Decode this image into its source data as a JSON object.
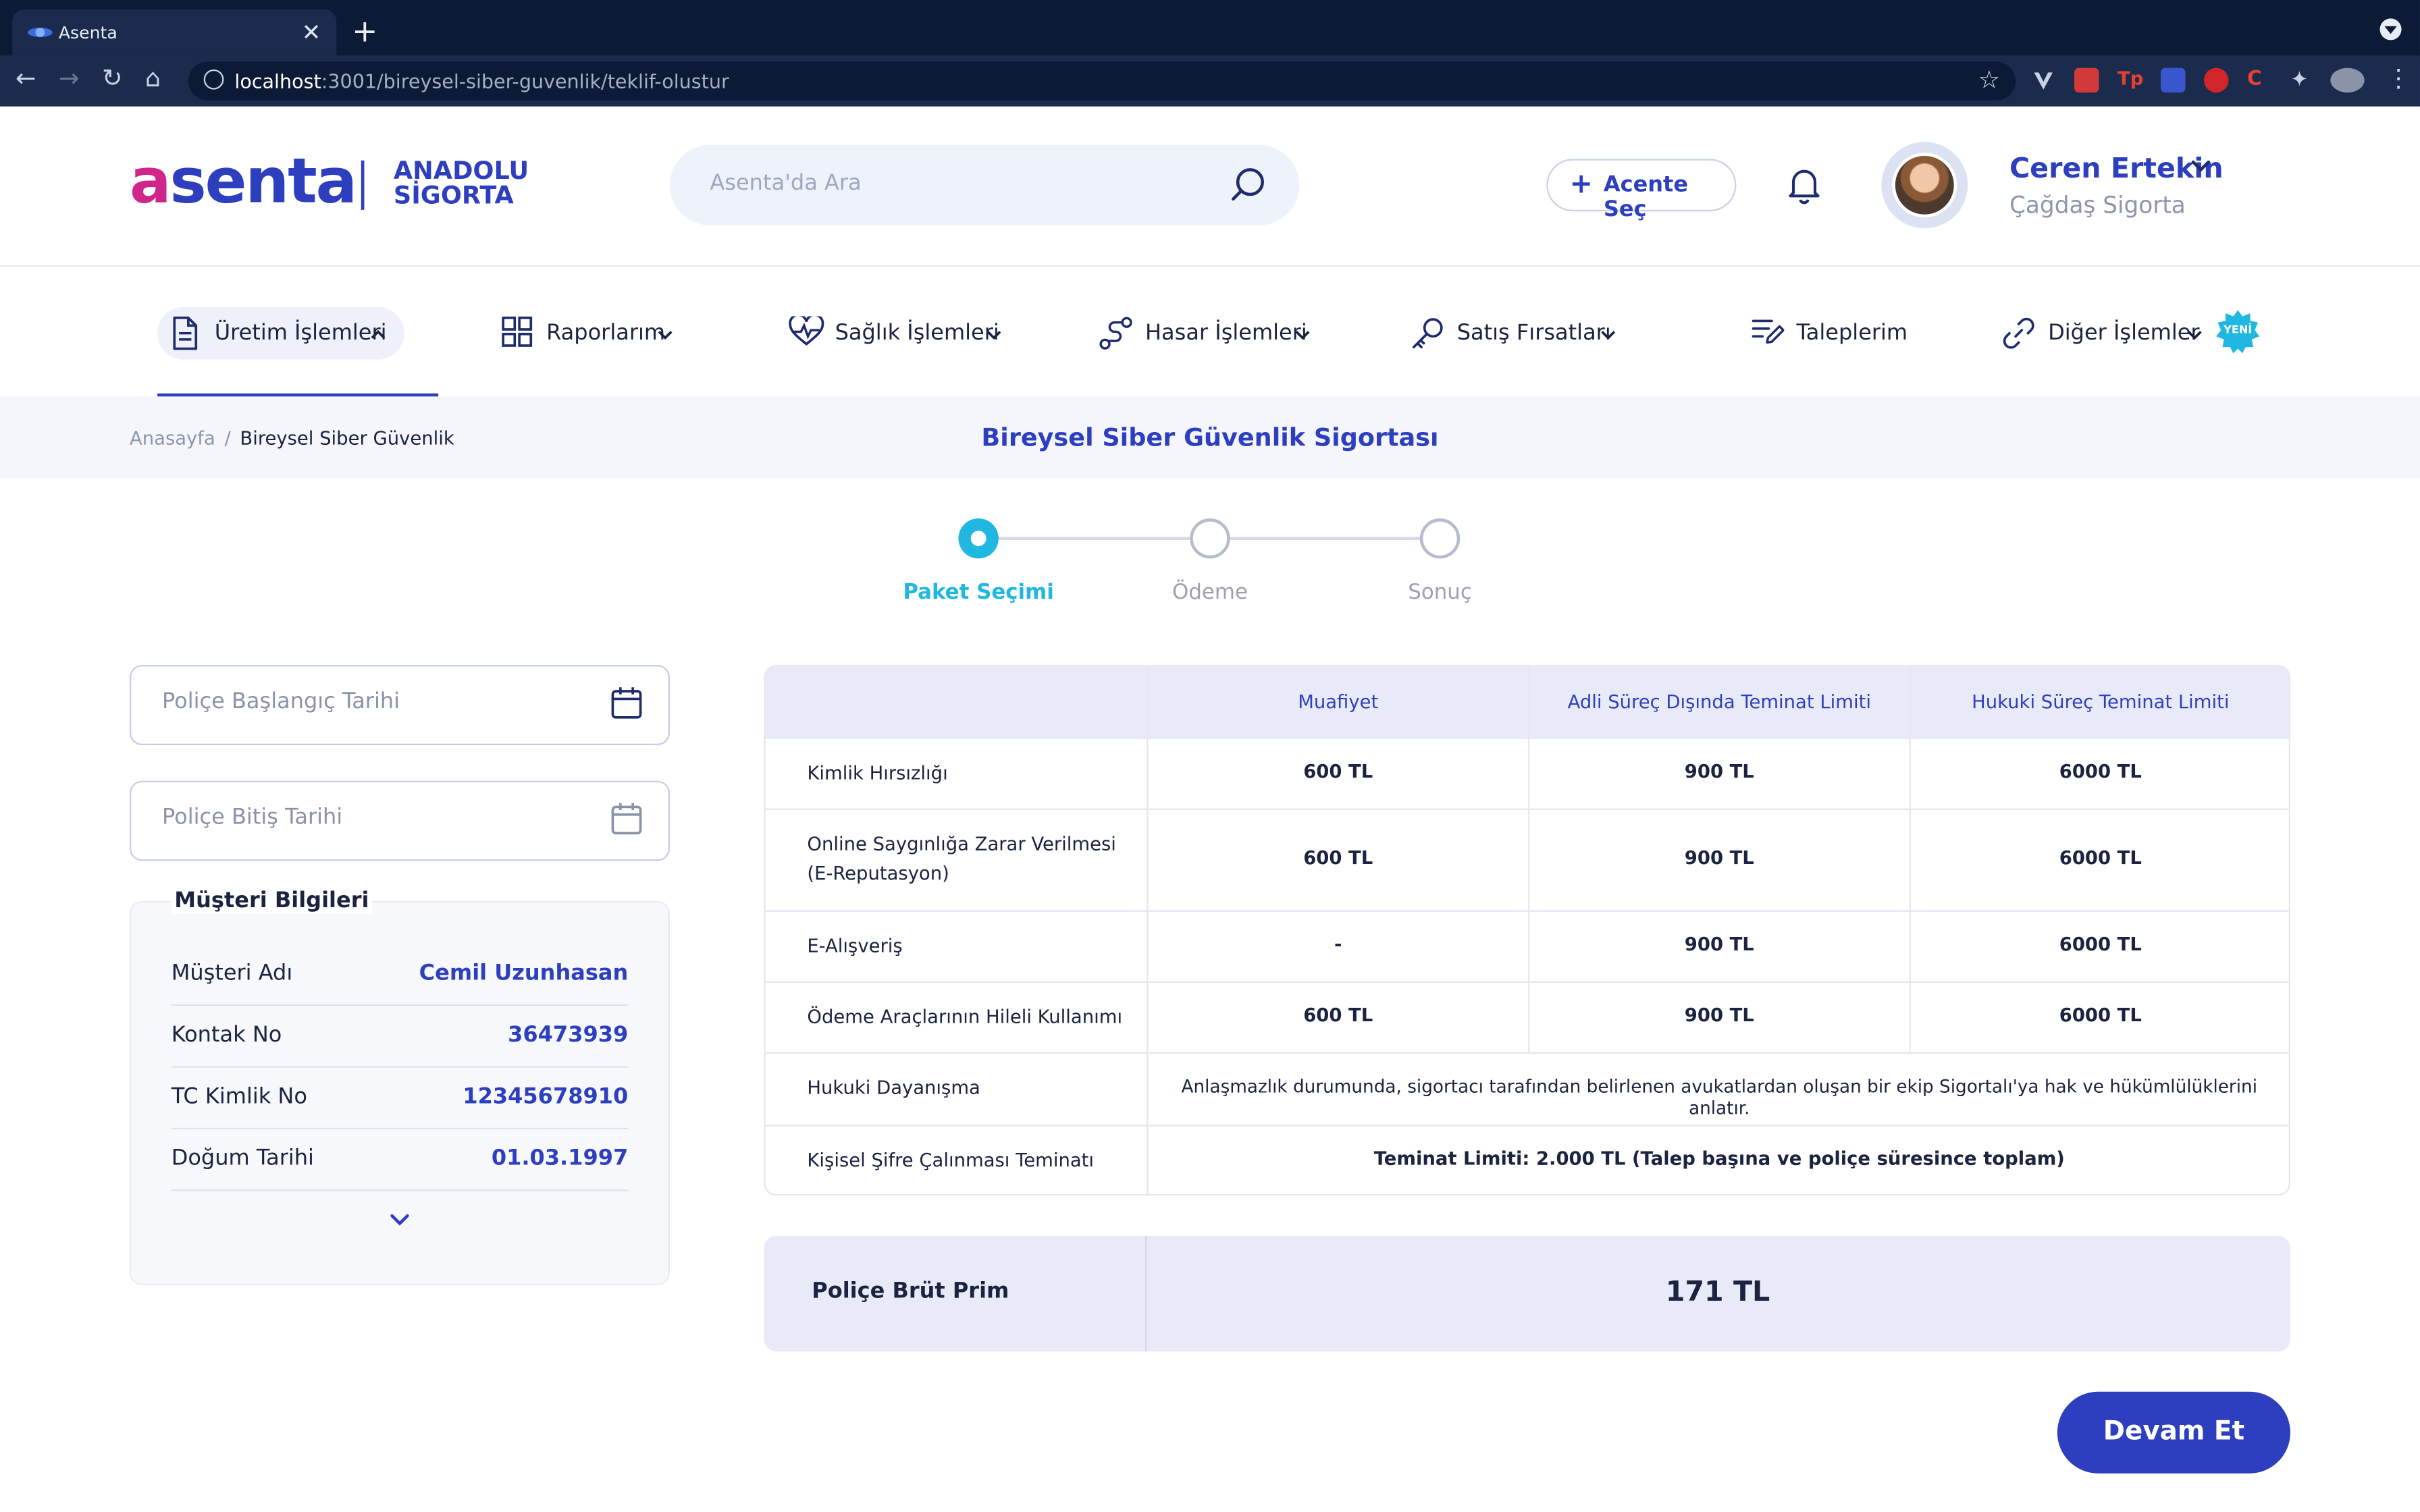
{
  "browser": {
    "tab_title": "Asenta",
    "tab_close": "✕",
    "new_tab": "+",
    "url_host": "localhost",
    "url_path": ":3001/bireysel-siber-guvenlik/teklif-olustur",
    "bookmark_icon": "star-icon"
  },
  "header": {
    "logo_first": "a",
    "logo_rest": "senta",
    "partner_line1": "ANADOLU",
    "partner_line2": "SİGORTA",
    "search_placeholder": "Asenta'da Ara",
    "acente_button": "Acente Seç",
    "user_name": "Ceren Ertekin",
    "user_org": "Çağdaş Sigorta"
  },
  "nav": {
    "items": [
      {
        "label": "Üretim İşlemleri",
        "icon": "document-icon"
      },
      {
        "label": "Raporlarım",
        "icon": "grid-icon"
      },
      {
        "label": "Sağlık İşlemleri",
        "icon": "heart-pulse-icon"
      },
      {
        "label": "Hasar İşlemleri",
        "icon": "route-icon"
      },
      {
        "label": "Satış Fırsatları",
        "icon": "key-icon"
      },
      {
        "label": "Taleplerim",
        "icon": "note-edit-icon"
      },
      {
        "label": "Diğer İşlemler",
        "icon": "link-icon"
      }
    ],
    "new_badge": "YENİ"
  },
  "breadcrumb": {
    "home": "Anasayfa",
    "separator": "/",
    "current": "Bireysel Siber Güvenlik"
  },
  "page_title": "Bireysel Siber Güvenlik Sigortası",
  "stepper": {
    "steps": [
      "Paket Seçimi",
      "Ödeme",
      "Sonuç"
    ],
    "active": 0
  },
  "dates": {
    "start_placeholder": "Poliçe Başlangıç Tarihi",
    "end_placeholder": "Poliçe Bitiş Tarihi"
  },
  "customer": {
    "title": "Müşteri Bilgileri",
    "rows": [
      {
        "label": "Müşteri Adı",
        "value": "Cemil Uzunhasan"
      },
      {
        "label": "Kontak No",
        "value": "36473939"
      },
      {
        "label": "TC Kimlik No",
        "value": "12345678910"
      },
      {
        "label": "Doğum Tarihi",
        "value": "01.03.1997"
      }
    ]
  },
  "coverage": {
    "columns": [
      "Muafiyet",
      "Adli Süreç Dışında Teminat Limiti",
      "Hukuki Süreç Teminat Limiti"
    ],
    "rows": [
      {
        "name": "Kimlik Hırsızlığı",
        "values": [
          "600 TL",
          "900 TL",
          "6000 TL"
        ]
      },
      {
        "name_line1": "Online Saygınlığa Zarar Verilmesi",
        "name_line2": "(E-Reputasyon)",
        "values": [
          "600 TL",
          "900 TL",
          "6000 TL"
        ]
      },
      {
        "name": "E-Alışveriş",
        "values": [
          "-",
          "900 TL",
          "6000 TL"
        ]
      },
      {
        "name": "Ödeme Araçlarının Hileli Kullanımı",
        "values": [
          "600 TL",
          "900 TL",
          "6000 TL"
        ]
      }
    ],
    "legal": {
      "name": "Hukuki Dayanışma",
      "text": "Anlaşmazlık durumunda, sigortacı tarafından belirlenen avukatlardan oluşan bir ekip Sigortalı'ya hak ve hükümlülüklerini anlatır."
    },
    "password": {
      "name": "Kişisel Şifre Çalınması Teminatı",
      "text": "Teminat Limiti: 2.000 TL (Talep başına ve poliçe süresince toplam)"
    }
  },
  "premium": {
    "label": "Poliçe Brüt Prim",
    "value": "171 TL"
  },
  "continue_button": "Devam Et",
  "colors": {
    "brand": "#2d3fbf",
    "accent": "#20b8e0",
    "logo_pink": "#d0258a"
  }
}
